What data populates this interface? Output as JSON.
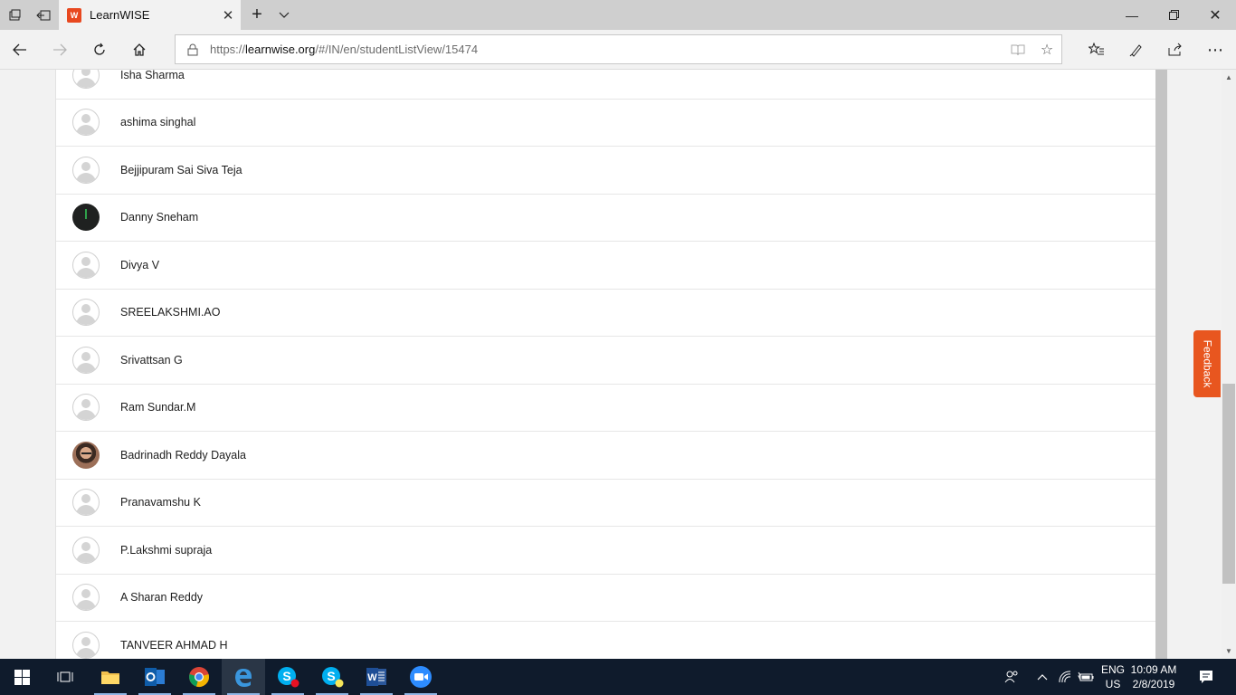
{
  "browser": {
    "tab_title": "LearnWISE",
    "tab_favicon_letter": "W",
    "url_prefix": "https://",
    "url_domain": "learnwise.org",
    "url_path": "/#/IN/en/studentListView/15474",
    "accent": "#e8481f"
  },
  "students": [
    {
      "name": "Isha Sharma",
      "avatar": "default"
    },
    {
      "name": "ashima singhal",
      "avatar": "default"
    },
    {
      "name": "Bejjipuram Sai Siva Teja",
      "avatar": "default"
    },
    {
      "name": "Danny Sneham",
      "avatar": "dark"
    },
    {
      "name": "Divya V",
      "avatar": "default"
    },
    {
      "name": "SREELAKSHMI.AO",
      "avatar": "default"
    },
    {
      "name": "Srivattsan G",
      "avatar": "default"
    },
    {
      "name": "Ram Sundar.M",
      "avatar": "default"
    },
    {
      "name": "Badrinadh Reddy Dayala",
      "avatar": "photo"
    },
    {
      "name": "Pranavamshu K",
      "avatar": "default"
    },
    {
      "name": "P.Lakshmi supraja",
      "avatar": "default"
    },
    {
      "name": "A Sharan Reddy",
      "avatar": "default"
    },
    {
      "name": "TANVEER AHMAD H",
      "avatar": "default"
    }
  ],
  "feedback": {
    "label": "Feedback",
    "color": "#e8561f"
  },
  "taskbar": {
    "apps": [
      "start-icon",
      "task-view-icon",
      "file-explorer-icon",
      "outlook-icon",
      "chrome-icon",
      "edge-icon",
      "skype-business-icon",
      "skype-icon",
      "word-icon",
      "zoom-icon"
    ],
    "lang_line1": "ENG",
    "lang_line2": "US",
    "time": "10:09 AM",
    "date": "2/8/2019"
  }
}
